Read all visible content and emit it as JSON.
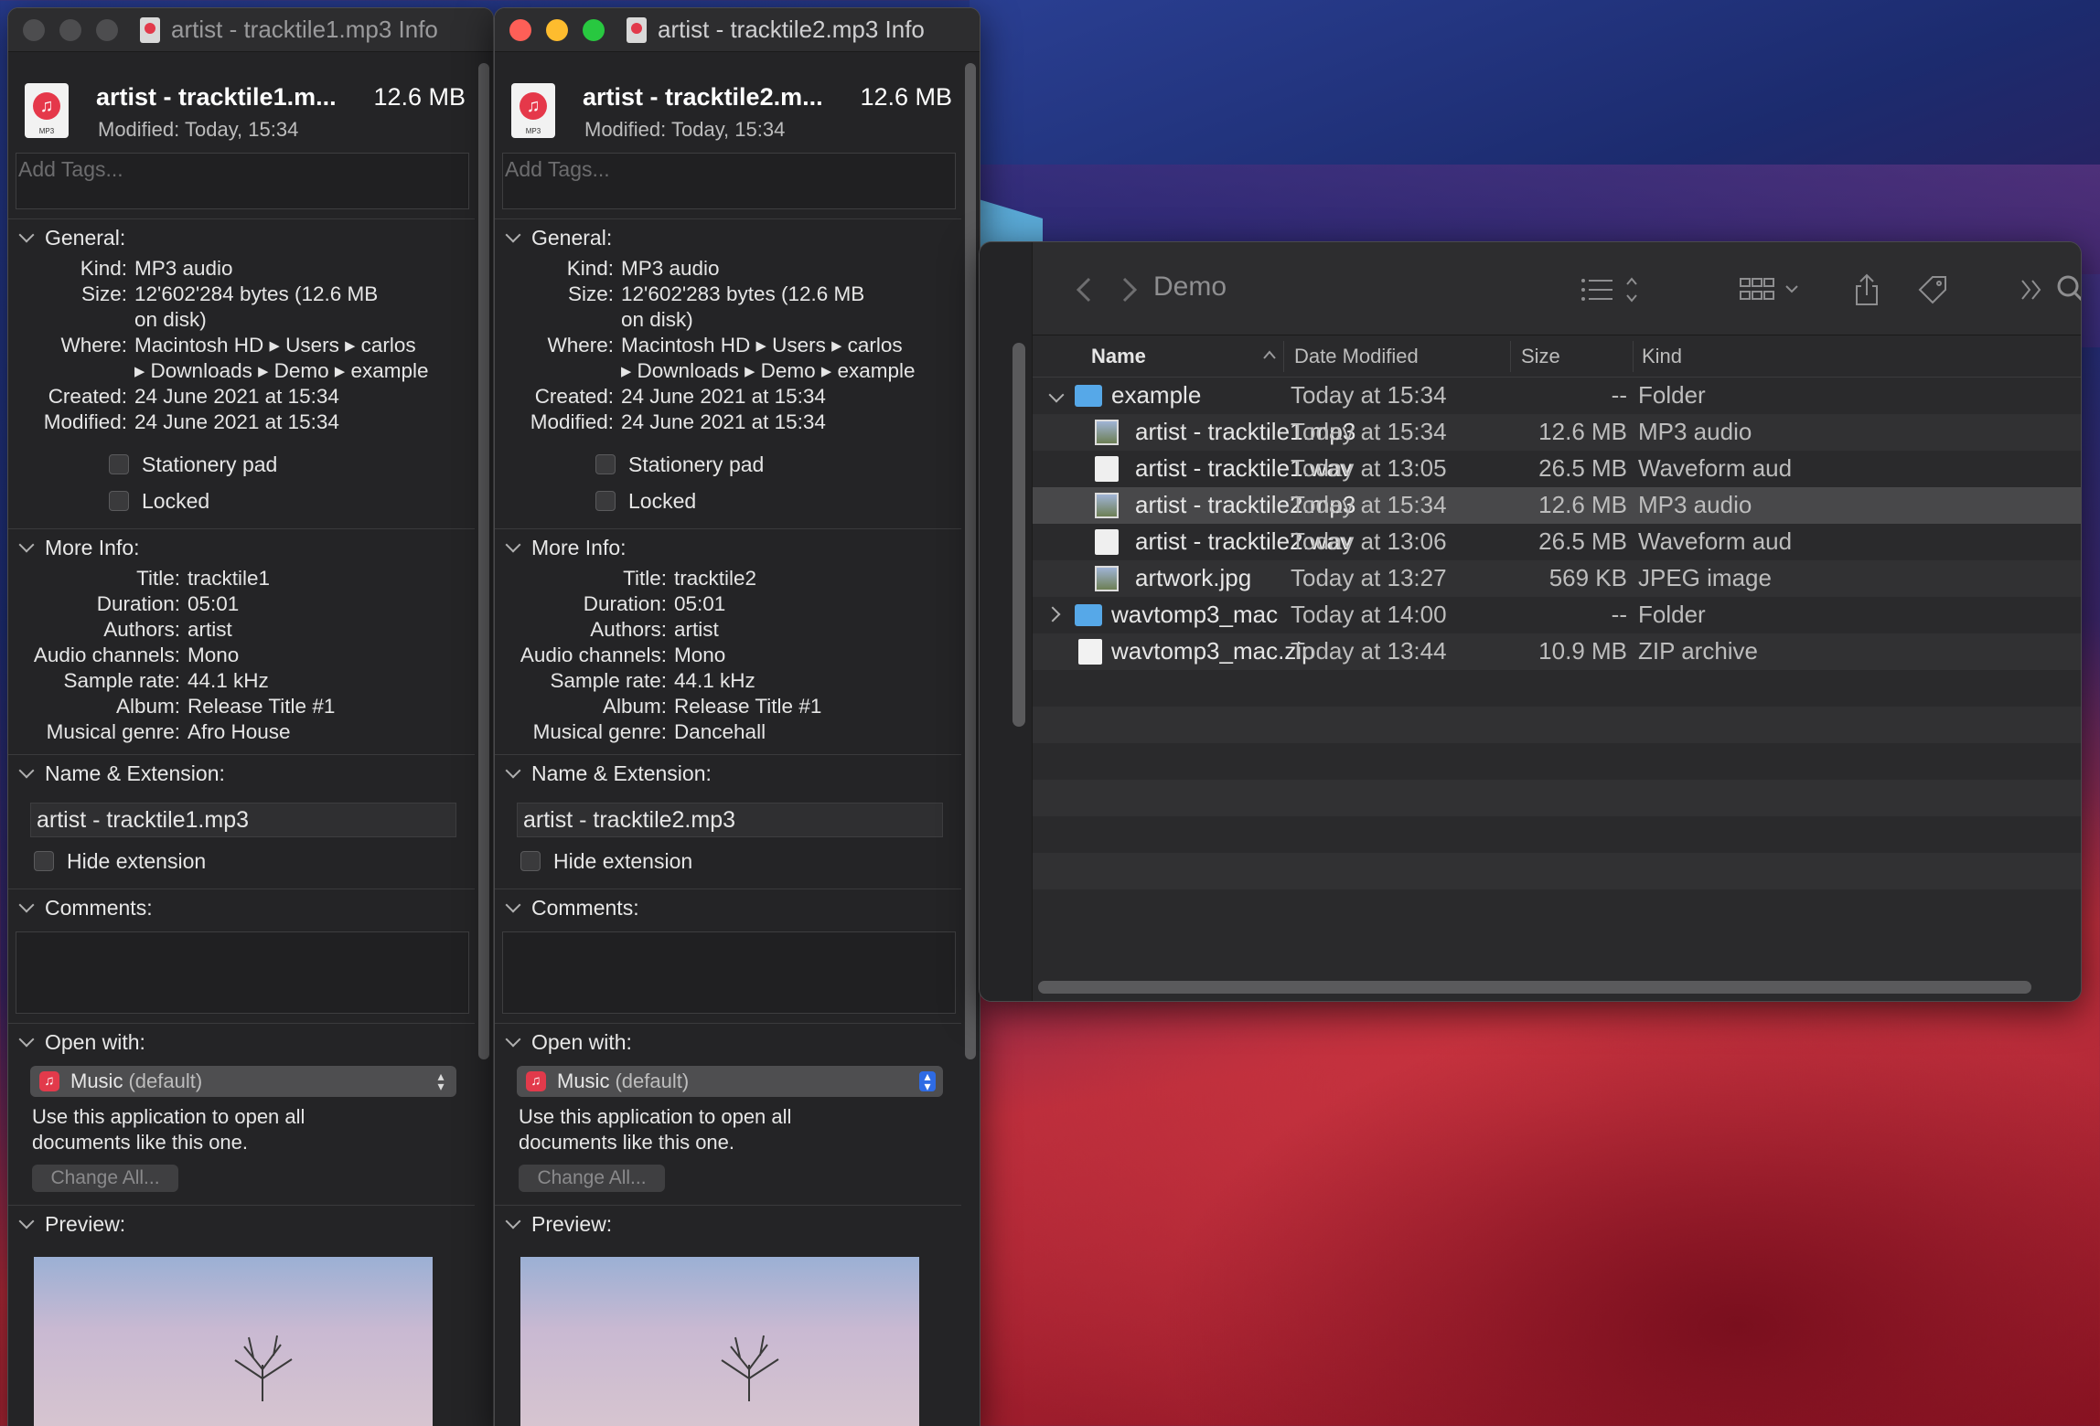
{
  "info1": {
    "title": "artist - tracktile1.mp3 Info",
    "file_name": "artist - tracktile1.m...",
    "file_size": "12.6 MB",
    "modified_line": "Modified: Today, 15:34",
    "icon_label": "MP3",
    "tags_placeholder": "Add Tags...",
    "general_label": "General:",
    "kind_k": "Kind:",
    "kind_v": "MP3 audio",
    "size_k": "Size:",
    "size_v1": "12'602'284 bytes (12.6 MB",
    "size_v2": "on disk)",
    "where_k": "Where:",
    "where_v1": "Macintosh HD ▸ Users ▸ carlos",
    "where_v2": "▸ Downloads ▸ Demo ▸ example",
    "created_k": "Created:",
    "created_v": "24 June 2021 at 15:34",
    "modified_k": "Modified:",
    "modified_v": "24 June 2021 at 15:34",
    "stationery": "Stationery pad",
    "locked": "Locked",
    "more_label": "More Info:",
    "title_k": "Title:",
    "title_v": "tracktile1",
    "duration_k": "Duration:",
    "duration_v": "05:01",
    "authors_k": "Authors:",
    "authors_v": "artist",
    "channels_k": "Audio channels:",
    "channels_v": "Mono",
    "rate_k": "Sample rate:",
    "rate_v": "44.1 kHz",
    "album_k": "Album:",
    "album_v": "Release Title #1",
    "genre_k": "Musical genre:",
    "genre_v": "Afro House",
    "name_ext_label": "Name & Extension:",
    "name_value": "artist - tracktile1.mp3",
    "hide_ext": "Hide extension",
    "comments_label": "Comments:",
    "open_with_label": "Open with:",
    "app_name": "Music",
    "app_default": "(default)",
    "open_with_text": "Use this application to open all documents like this one.",
    "change_all": "Change All...",
    "preview_label": "Preview:"
  },
  "info2": {
    "title": "artist - tracktile2.mp3 Info",
    "file_name": "artist - tracktile2.m...",
    "file_size": "12.6 MB",
    "modified_line": "Modified: Today, 15:34",
    "icon_label": "MP3",
    "tags_placeholder": "Add Tags...",
    "general_label": "General:",
    "kind_k": "Kind:",
    "kind_v": "MP3 audio",
    "size_k": "Size:",
    "size_v1": "12'602'283 bytes (12.6 MB",
    "size_v2": "on disk)",
    "where_k": "Where:",
    "where_v1": "Macintosh HD ▸ Users ▸ carlos",
    "where_v2": "▸ Downloads ▸ Demo ▸ example",
    "created_k": "Created:",
    "created_v": "24 June 2021 at 15:34",
    "modified_k": "Modified:",
    "modified_v": "24 June 2021 at 15:34",
    "stationery": "Stationery pad",
    "locked": "Locked",
    "more_label": "More Info:",
    "title_k": "Title:",
    "title_v": "tracktile2",
    "duration_k": "Duration:",
    "duration_v": "05:01",
    "authors_k": "Authors:",
    "authors_v": "artist",
    "channels_k": "Audio channels:",
    "channels_v": "Mono",
    "rate_k": "Sample rate:",
    "rate_v": "44.1 kHz",
    "album_k": "Album:",
    "album_v": "Release Title #1",
    "genre_k": "Musical genre:",
    "genre_v": "Dancehall",
    "name_ext_label": "Name & Extension:",
    "name_value": "artist - tracktile2.mp3",
    "hide_ext": "Hide extension",
    "comments_label": "Comments:",
    "open_with_label": "Open with:",
    "app_name": "Music",
    "app_default": "(default)",
    "open_with_text": "Use this application to open all documents like this one.",
    "change_all": "Change All...",
    "preview_label": "Preview:"
  },
  "finder": {
    "title": "Demo",
    "columns": {
      "name": "Name",
      "date": "Date Modified",
      "size": "Size",
      "kind": "Kind"
    },
    "rows": [
      {
        "name": "example",
        "date": "Today at 15:34",
        "size": "--",
        "kind": "Folder"
      },
      {
        "name": "artist - tracktile1.mp3",
        "date": "Today at 15:34",
        "size": "12.6 MB",
        "kind": "MP3 audio"
      },
      {
        "name": "artist - tracktile1.wav",
        "date": "Today at 13:05",
        "size": "26.5 MB",
        "kind": "Waveform aud"
      },
      {
        "name": "artist - tracktile2.mp3",
        "date": "Today at 15:34",
        "size": "12.6 MB",
        "kind": "MP3 audio"
      },
      {
        "name": "artist - tracktile2.wav",
        "date": "Today at 13:06",
        "size": "26.5 MB",
        "kind": "Waveform aud"
      },
      {
        "name": "artwork.jpg",
        "date": "Today at 13:27",
        "size": "569 KB",
        "kind": "JPEG image"
      },
      {
        "name": "wavtomp3_mac",
        "date": "Today at 14:00",
        "size": "--",
        "kind": "Folder"
      },
      {
        "name": "wavtomp3_mac.zip",
        "date": "Today at 13:44",
        "size": "10.9 MB",
        "kind": "ZIP archive"
      }
    ]
  },
  "colors": {
    "accent": "#2e6be4",
    "close": "#fe5f57",
    "minimize": "#febc2e",
    "zoom": "#28c840",
    "folder": "#56a8e8",
    "music": "#e23a4b"
  }
}
